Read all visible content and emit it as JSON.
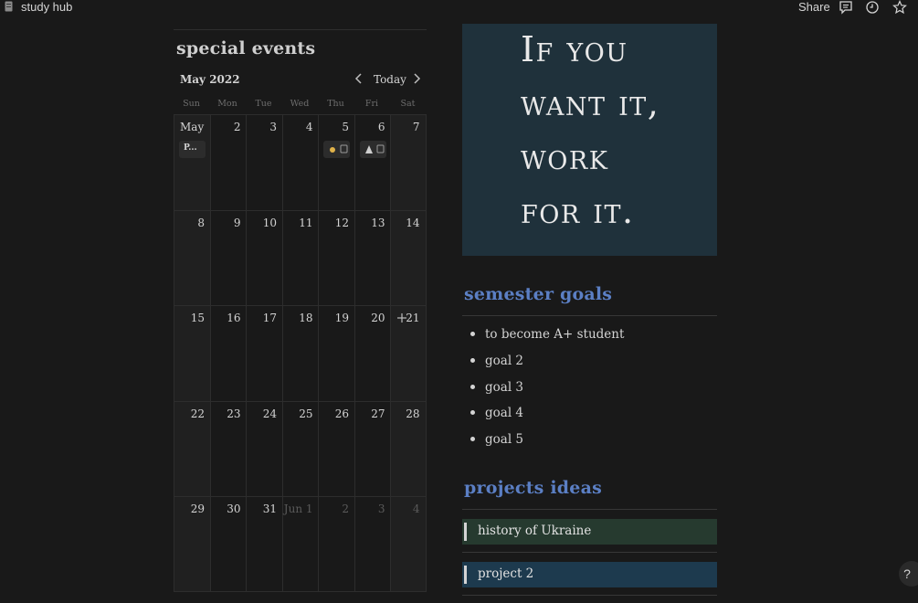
{
  "topbar": {
    "page_title": "study hub",
    "share_label": "Share",
    "icons": [
      "page-icon",
      "comment-icon",
      "history-icon",
      "favorite-icon"
    ]
  },
  "calendar": {
    "heading": "special events",
    "month_label": "May 2022",
    "today_label": "Today",
    "weekdays": [
      "Sun",
      "Mon",
      "Tue",
      "Wed",
      "Thu",
      "Fri",
      "Sat"
    ],
    "weeks": [
      [
        "May",
        "2",
        "3",
        "4",
        "5",
        "6",
        "7"
      ],
      [
        "8",
        "9",
        "10",
        "11",
        "12",
        "13",
        "14"
      ],
      [
        "15",
        "16",
        "17",
        "18",
        "19",
        "20",
        "21"
      ],
      [
        "22",
        "23",
        "24",
        "25",
        "26",
        "27",
        "28"
      ],
      [
        "29",
        "30",
        "31",
        "Jun 1",
        "2",
        "3",
        "4"
      ]
    ],
    "events": {
      "sun_may1": "P..."
    }
  },
  "quote": {
    "lines": [
      "If you",
      "want it,",
      "work",
      "for it."
    ]
  },
  "goals": {
    "title": "semester goals",
    "items": [
      "to become A+ student",
      "goal 2",
      "goal 3",
      "goal 4",
      "goal 5"
    ]
  },
  "projects": {
    "title": "projects ideas",
    "items": [
      {
        "label": "history of Ukraine",
        "color": "#263a2f"
      },
      {
        "label": "project 2",
        "color": "#1d3a4e"
      }
    ]
  },
  "help_label": "?",
  "colors": {
    "background": "#191919",
    "accent_heading": "#5b7fc4",
    "quote_bg": "#1f313b"
  }
}
